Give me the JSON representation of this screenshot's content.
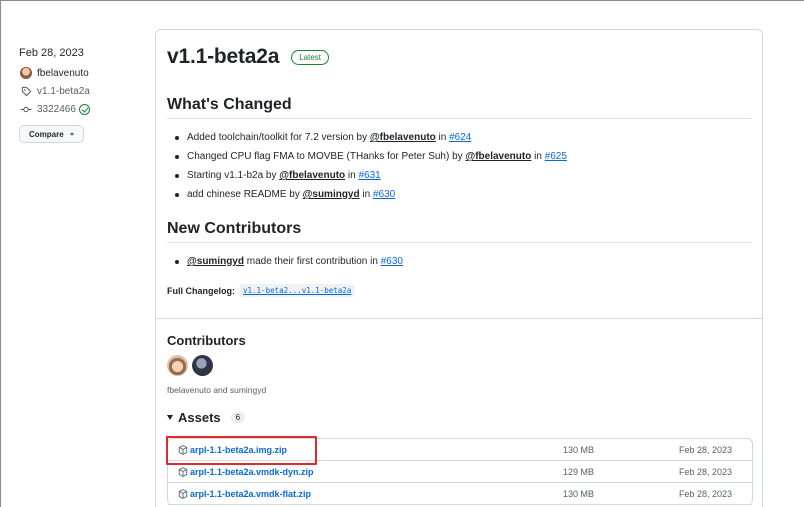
{
  "meta": {
    "date": "Feb 28, 2023",
    "author": "fbelavenuto",
    "tag": "v1.1-beta2a",
    "commit": "3322466",
    "compare_label": "Compare"
  },
  "release": {
    "title": "v1.1-beta2a",
    "badge": "Latest",
    "whats_changed": {
      "heading": "What's Changed",
      "items": [
        {
          "text": "Added toolchain/toolkit for 7.2 version by ",
          "mention": "@fbelavenuto",
          "mid": " in ",
          "pr": "#624"
        },
        {
          "text": "Changed CPU flag FMA to MOVBE (THanks for Peter Suh) by ",
          "mention": "@fbelavenuto",
          "mid": " in ",
          "pr": "#625"
        },
        {
          "text": "Starting v1.1-b2a by ",
          "mention": "@fbelavenuto",
          "mid": " in ",
          "pr": "#631"
        },
        {
          "text": "add chinese README by ",
          "mention": "@sumingyd",
          "mid": " in ",
          "pr": "#630"
        }
      ]
    },
    "new_contributors": {
      "heading": "New Contributors",
      "items": [
        {
          "mention": "@sumingyd",
          "text": " made their first contribution in ",
          "pr": "#630"
        }
      ]
    },
    "changelog": {
      "label": "Full Changelog:",
      "link": "v1.1-beta2...v1.1-beta2a"
    }
  },
  "contributors": {
    "heading": "Contributors",
    "names": "fbelavenuto and sumingyd"
  },
  "assets": {
    "heading": "Assets",
    "count": "6",
    "rows": [
      {
        "name": "arpl-1.1-beta2a.img.zip",
        "size": "130 MB",
        "date": "Feb 28, 2023"
      },
      {
        "name": "arpl-1.1-beta2a.vmdk-dyn.zip",
        "size": "129 MB",
        "date": "Feb 28, 2023"
      },
      {
        "name": "arpl-1.1-beta2a.vmdk-flat.zip",
        "size": "130 MB",
        "date": "Feb 28, 2023"
      }
    ]
  },
  "colors": {
    "link": "#0969da",
    "latest": "#1a7f37",
    "highlight": "#e0282e"
  }
}
